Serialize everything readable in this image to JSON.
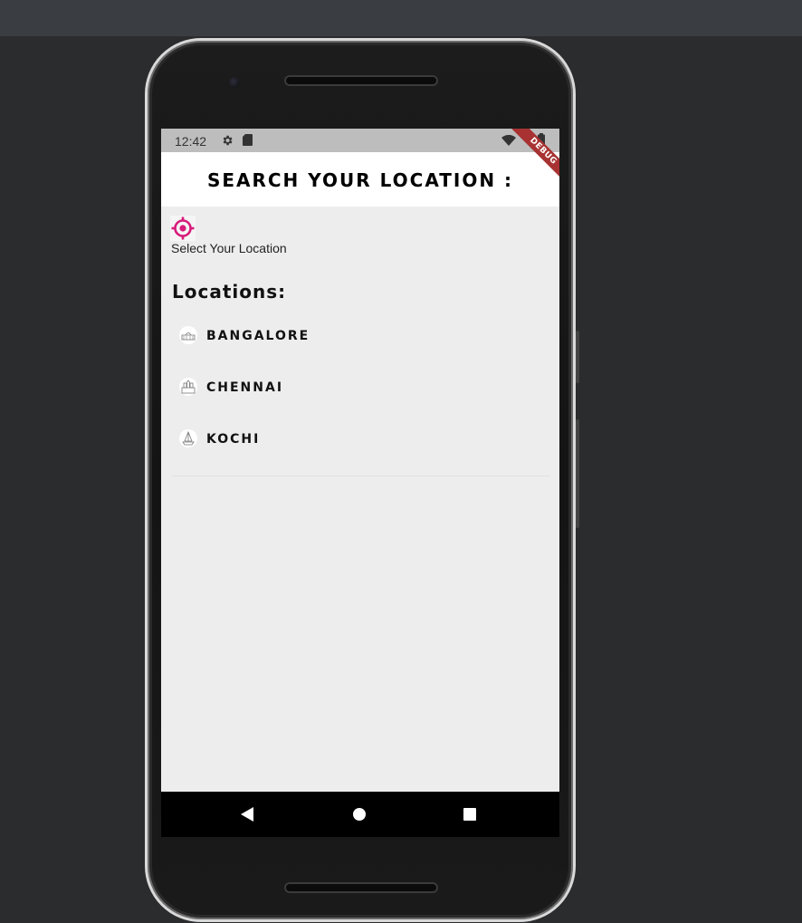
{
  "status_bar": {
    "time": "12:42",
    "icons": [
      "gear-icon",
      "sd-card-icon",
      "wifi-icon",
      "battery-icon"
    ]
  },
  "debug_banner": "DEBUG",
  "app_bar": {
    "title": "SEARCH YOUR LOCATION :"
  },
  "locate": {
    "icon": "crosshair-target-icon",
    "icon_color": "#d81b7a",
    "label": "Select Your Location"
  },
  "locations": {
    "title": "Locations:",
    "items": [
      {
        "label": "BANGALORE",
        "icon": "palace-icon"
      },
      {
        "label": "CHENNAI",
        "icon": "temple-icon"
      },
      {
        "label": "KOCHI",
        "icon": "boat-icon"
      }
    ]
  },
  "nav_bar": {
    "icons": [
      "back-icon",
      "home-icon",
      "recents-icon"
    ]
  }
}
